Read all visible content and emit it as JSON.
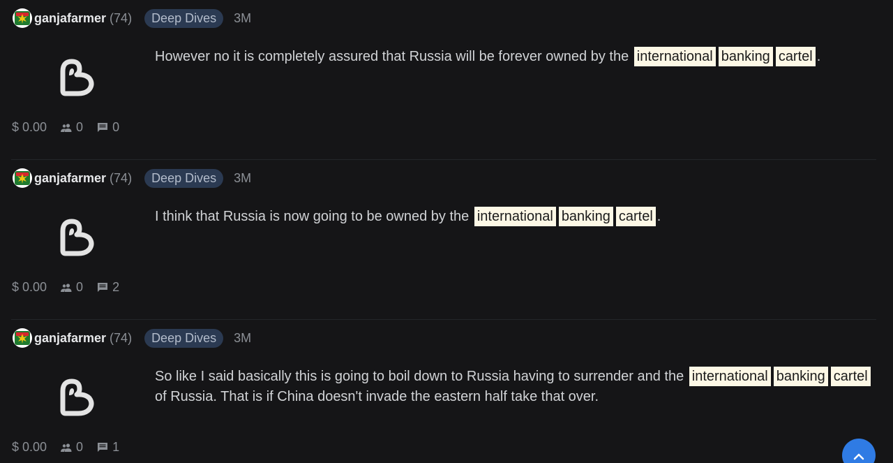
{
  "posts": [
    {
      "author": "ganjafarmer",
      "reputation": "(74)",
      "community": "Deep Dives",
      "age": "3M",
      "body_before": "However no it is completely assured that Russia will be forever owned by the",
      "tags": [
        "international",
        "banking",
        "cartel"
      ],
      "body_after": ".",
      "payout": "$ 0.00",
      "votes": "0",
      "comments": "0"
    },
    {
      "author": "ganjafarmer",
      "reputation": "(74)",
      "community": "Deep Dives",
      "age": "3M",
      "body_before": "I think that Russia is now going to be owned by the",
      "tags": [
        "international",
        "banking",
        "cartel"
      ],
      "body_after": ".",
      "payout": "$ 0.00",
      "votes": "0",
      "comments": "2"
    },
    {
      "author": "ganjafarmer",
      "reputation": "(74)",
      "community": "Deep Dives",
      "age": "3M",
      "body_before": "So like I said basically this is going to boil down to Russia having to surrender and the",
      "tags": [
        "international",
        "banking",
        "cartel"
      ],
      "body_after": "of Russia. That is if China doesn't invade the eastern half take that over.",
      "payout": "$ 0.00",
      "votes": "0",
      "comments": "1"
    }
  ],
  "icons": {
    "avatar": "cannabis-leaf-avatar",
    "thumbnail": "app-logo-placeholder",
    "votes": "people-icon",
    "comments": "comment-icon",
    "scroll_top": "chevron-up-icon"
  },
  "colors": {
    "background": "#151517",
    "badge_bg": "#2b3a52",
    "tag_bg": "#fdf8e6",
    "scroll_button": "#2f7be4"
  }
}
